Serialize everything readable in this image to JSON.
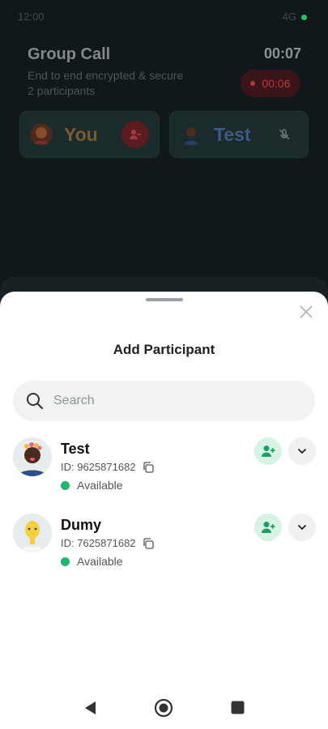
{
  "status_bar": {
    "time": "12:00",
    "right": "4G"
  },
  "call": {
    "title": "Group Call",
    "subtitle": "End to end encrypted & secure",
    "participants_count": "2 participants",
    "timer": "00:07",
    "recording_time": "00:06",
    "tiles": [
      {
        "name": "You"
      },
      {
        "name": "Test"
      }
    ]
  },
  "sheet": {
    "title": "Add Participant",
    "search_placeholder": "Search",
    "participants": [
      {
        "name": "Test",
        "id": "ID: 9625871682",
        "status": "Available"
      },
      {
        "name": "Dumy",
        "id": "ID: 7625871682",
        "status": "Available"
      }
    ]
  },
  "colors": {
    "accent_green": "#22b573",
    "recording_red": "#b23b3f"
  }
}
